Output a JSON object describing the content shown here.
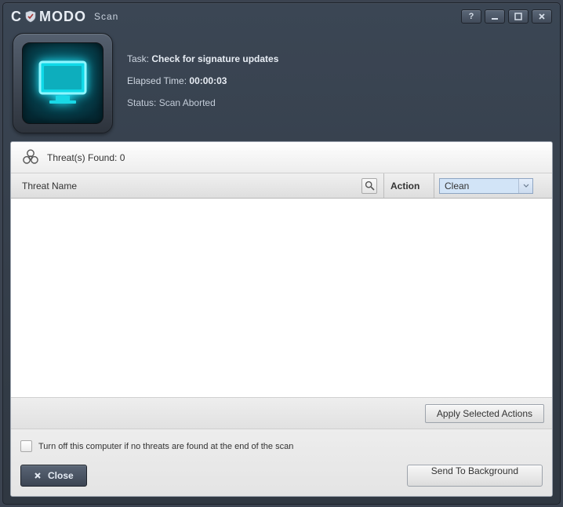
{
  "titlebar": {
    "brand": "COMODO",
    "subtitle": "Scan"
  },
  "header": {
    "task_label": "Task:",
    "task_value": "Check for signature updates",
    "elapsed_label": "Elapsed Time:",
    "elapsed_value": "00:00:03",
    "status_label": "Status:",
    "status_value": "Scan Aborted"
  },
  "threats": {
    "found_label": "Threat(s) Found:",
    "found_count": "0"
  },
  "table": {
    "threat_name_header": "Threat Name",
    "action_header": "Action",
    "action_selected": "Clean",
    "rows": []
  },
  "buttons": {
    "apply": "Apply Selected Actions",
    "close": "Close",
    "send_bg": "Send To Background"
  },
  "footer": {
    "turn_off_label": "Turn off this computer if no threats are found at the end of the scan",
    "turn_off_checked": false
  }
}
